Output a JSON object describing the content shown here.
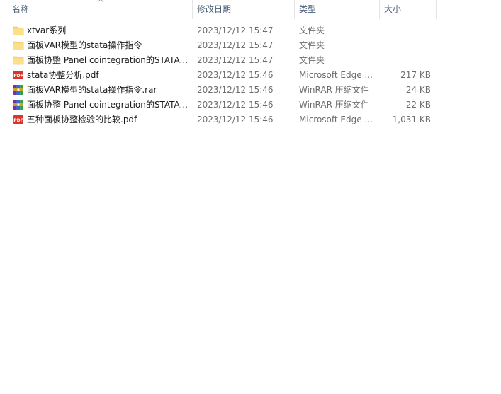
{
  "columns": {
    "name": "名称",
    "date": "修改日期",
    "type": "类型",
    "size": "大小"
  },
  "files": [
    {
      "icon": "folder-icon",
      "name": "xtvar系列",
      "date": "2023/12/12 15:47",
      "type": "文件夹",
      "size": ""
    },
    {
      "icon": "folder-icon",
      "name": "面板VAR模型的stata操作指令",
      "date": "2023/12/12 15:47",
      "type": "文件夹",
      "size": ""
    },
    {
      "icon": "folder-icon",
      "name": "面板协整  Panel cointegration的STATA...",
      "date": "2023/12/12 15:47",
      "type": "文件夹",
      "size": ""
    },
    {
      "icon": "pdf-icon",
      "name": "stata协整分析.pdf",
      "date": "2023/12/12 15:46",
      "type": "Microsoft Edge ...",
      "size": "217 KB"
    },
    {
      "icon": "rar-icon",
      "name": "面板VAR模型的stata操作指令.rar",
      "date": "2023/12/12 15:46",
      "type": "WinRAR 压缩文件",
      "size": "24 KB"
    },
    {
      "icon": "rar-icon",
      "name": "面板协整  Panel cointegration的STATA...",
      "date": "2023/12/12 15:46",
      "type": "WinRAR 压缩文件",
      "size": "22 KB"
    },
    {
      "icon": "pdf-icon",
      "name": "五种面板协整检验的比较.pdf",
      "date": "2023/12/12 15:46",
      "type": "Microsoft Edge ...",
      "size": "1,031 KB"
    }
  ],
  "colors": {
    "header_text": "#4c607a",
    "folder": "#f8d775",
    "pdf": "#d9352b",
    "secondary_text": "#6d6d6d"
  }
}
